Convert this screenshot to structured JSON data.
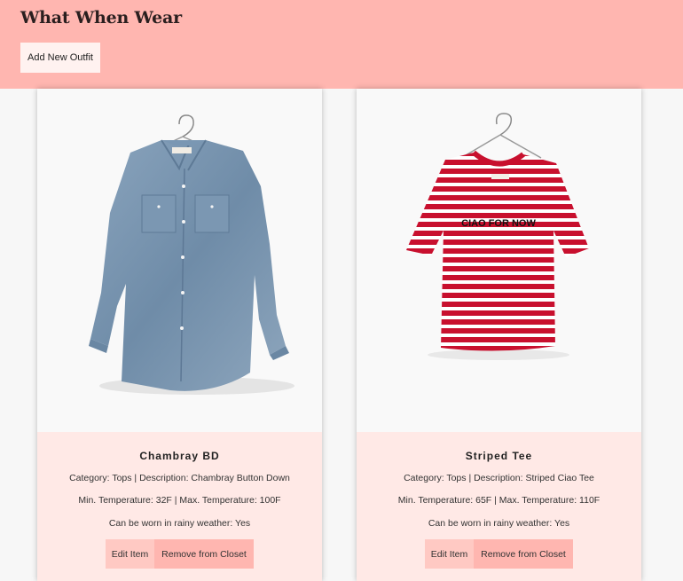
{
  "app": {
    "title": "What When Wear",
    "add_button_label": "Add New Outfit",
    "accent_color": "#ffb6b0",
    "card_body_color": "#ffe9e6"
  },
  "items": [
    {
      "name": "Chambray BD",
      "details_line1": "Category: Tops | Description: Chambray Button Down",
      "details_line2": "Min. Temperature: 32F | Max. Temperature: 100F",
      "details_line3": "Can be worn in rainy weather: Yes",
      "edit_label": "Edit Item",
      "remove_label": "Remove from Closet",
      "image": "denim-button-down-shirt-on-hanger"
    },
    {
      "name": "Striped Tee",
      "details_line1": "Category: Tops | Description: Striped Ciao Tee",
      "details_line2": "Min. Temperature: 65F | Max. Temperature: 110F",
      "details_line3": "Can be worn in rainy weather: Yes",
      "edit_label": "Edit Item",
      "remove_label": "Remove from Closet",
      "image": "red-white-striped-tee-on-hanger",
      "print_text": "CIAO FOR NOW"
    }
  ]
}
